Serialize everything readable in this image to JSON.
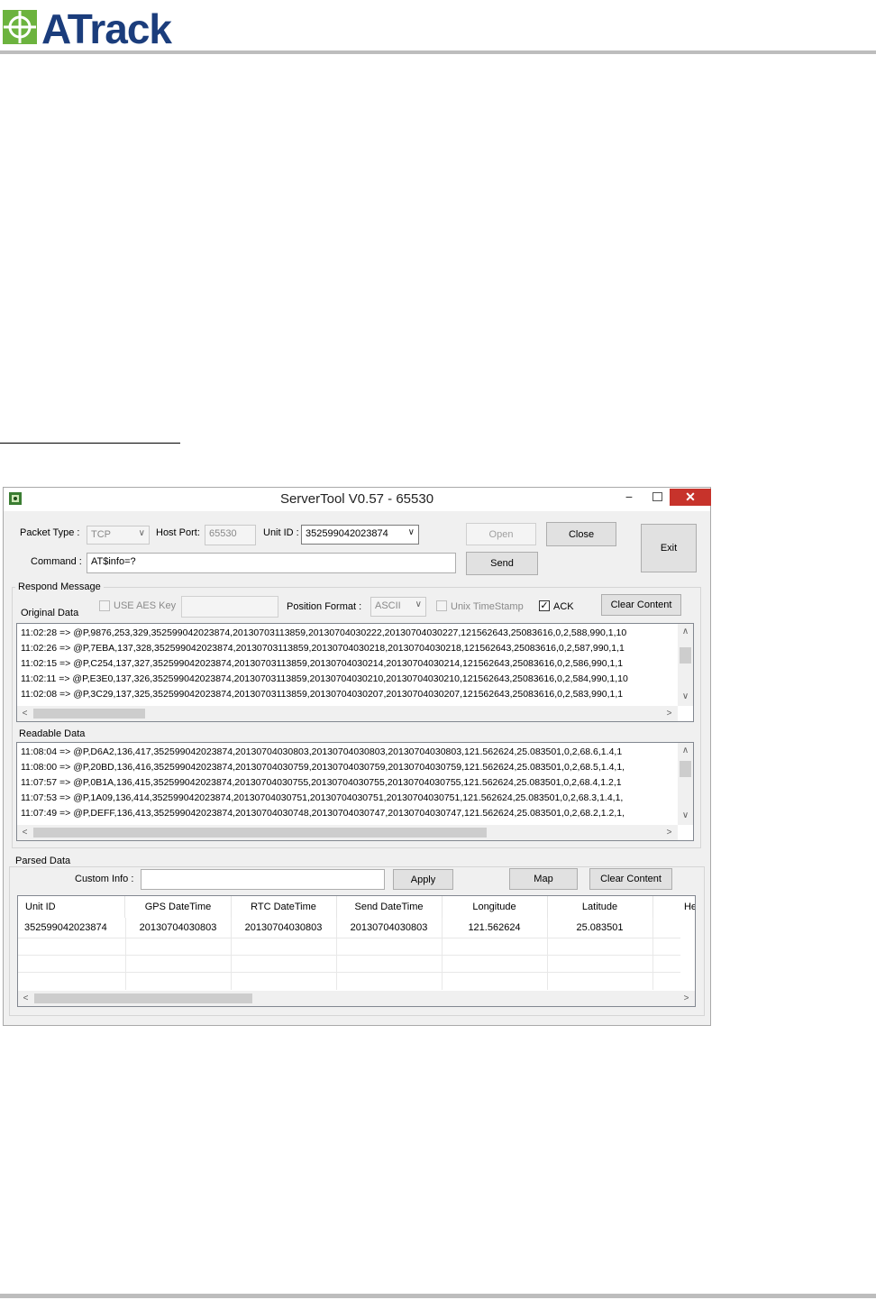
{
  "doc": {
    "logo_text": "ATrack"
  },
  "window": {
    "title": "ServerTool V0.57 - 65530",
    "minimize": "−",
    "close": "✕"
  },
  "toolbar": {
    "packet_type_label": "Packet Type :",
    "packet_type_value": "TCP",
    "host_port_label": "Host Port:",
    "host_port_value": "65530",
    "unit_id_label": "Unit ID :",
    "unit_id_value": "352599042023874",
    "open_label": "Open",
    "close_label": "Close",
    "exit_label": "Exit",
    "command_label": "Command :",
    "command_value": "AT$info=?",
    "send_label": "Send"
  },
  "respond": {
    "group_title": "Respond Message",
    "original_label": "Original Data",
    "use_aes_label": "USE AES Key",
    "position_format_label": "Position Format :",
    "position_format_value": "ASCII",
    "unix_ts_label": "Unix TimeStamp",
    "ack_label": "ACK",
    "ack_checked": "✓",
    "clear_label": "Clear Content",
    "original_lines": [
      "11:02:28 => @P,9876,253,329,352599042023874,20130703113859,20130704030222,20130704030227,121562643,25083616,0,2,588,990,1,10",
      "11:02:26 => @P,7EBA,137,328,352599042023874,20130703113859,20130704030218,20130704030218,121562643,25083616,0,2,587,990,1,1",
      "11:02:15 => @P,C254,137,327,352599042023874,20130703113859,20130704030214,20130704030214,121562643,25083616,0,2,586,990,1,1",
      "11:02:11 => @P,E3E0,137,326,352599042023874,20130703113859,20130704030210,20130704030210,121562643,25083616,0,2,584,990,1,10",
      "11:02:08 => @P,3C29,137,325,352599042023874,20130703113859,20130704030207,20130704030207,121562643,25083616,0,2,583,990,1,1"
    ],
    "readable_label": "Readable Data",
    "readable_lines": [
      "11:08:04 => @P,D6A2,136,417,352599042023874,20130704030803,20130704030803,20130704030803,121.562624,25.083501,0,2,68.6,1.4,1",
      "11:08:00 => @P,20BD,136,416,352599042023874,20130704030759,20130704030759,20130704030759,121.562624,25.083501,0,2,68.5,1.4,1,",
      "11:07:57 => @P,0B1A,136,415,352599042023874,20130704030755,20130704030755,20130704030755,121.562624,25.083501,0,2,68.4,1.2,1",
      "11:07:53 => @P,1A09,136,414,352599042023874,20130704030751,20130704030751,20130704030751,121.562624,25.083501,0,2,68.3,1.4,1,",
      "11:07:49 => @P,DEFF,136,413,352599042023874,20130704030748,20130704030747,20130704030747,121.562624,25.083501,0,2,68.2,1.2,1,"
    ]
  },
  "parsed": {
    "group_title": "Parsed Data",
    "custom_info_label": "Custom Info :",
    "custom_info_value": "",
    "apply_label": "Apply",
    "map_label": "Map",
    "clear_label": "Clear Content",
    "columns": [
      "Unit ID",
      "GPS DateTime",
      "RTC DateTime",
      "Send DateTime",
      "Longitude",
      "Latitude",
      "He"
    ],
    "rows": [
      [
        "352599042023874",
        "20130704030803",
        "20130704030803",
        "20130704030803",
        "121.562624",
        "25.083501",
        ""
      ]
    ]
  },
  "icons": {
    "scroll_up": "∧",
    "scroll_down": "∨",
    "scroll_left": "<",
    "scroll_right": ">",
    "dropdown": "∨"
  }
}
